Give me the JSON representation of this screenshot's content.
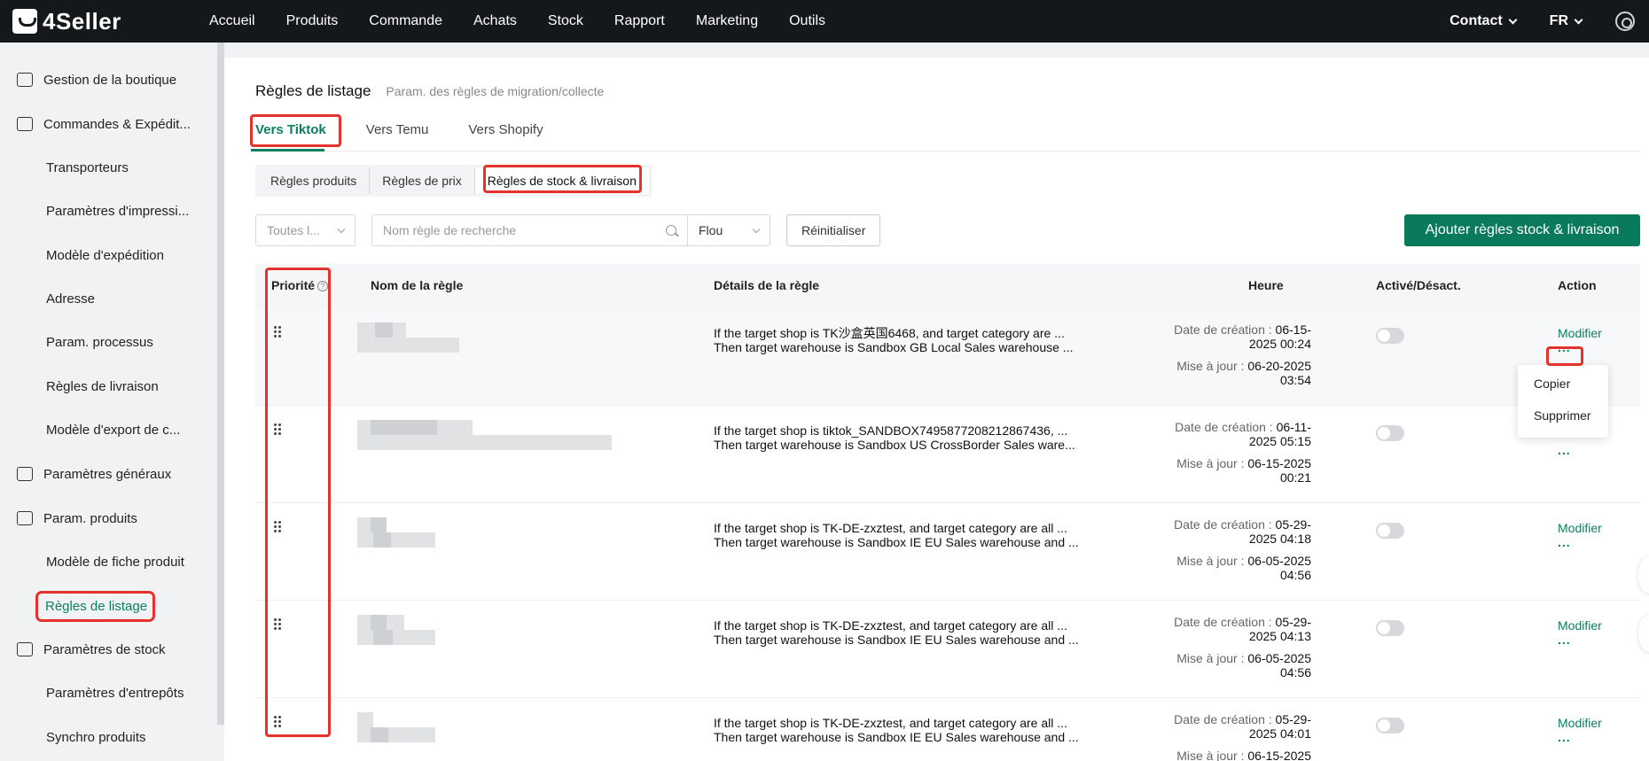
{
  "app": {
    "brand": "4Seller"
  },
  "top_nav": [
    "Accueil",
    "Produits",
    "Commande",
    "Achats",
    "Stock",
    "Rapport",
    "Marketing",
    "Outils"
  ],
  "top_right": {
    "contact": "Contact",
    "lang": "FR"
  },
  "sidebar": {
    "items": [
      {
        "label": "Gestion de la boutique",
        "icon": "shop-icon",
        "type": "section"
      },
      {
        "label": "Commandes & Expédit...",
        "icon": "orders-icon",
        "type": "section"
      },
      {
        "label": "Transporteurs",
        "type": "sub"
      },
      {
        "label": "Paramètres d'impressi...",
        "type": "sub"
      },
      {
        "label": "Modèle d'expédition",
        "type": "sub"
      },
      {
        "label": "Adresse",
        "type": "sub"
      },
      {
        "label": "Param. processus",
        "type": "sub"
      },
      {
        "label": "Règles de livraison",
        "type": "sub"
      },
      {
        "label": "Modèle d'export de c...",
        "type": "sub"
      },
      {
        "label": "Paramètres généraux",
        "icon": "settings-icon",
        "type": "section"
      },
      {
        "label": "Param. produits",
        "icon": "product-icon",
        "type": "section"
      },
      {
        "label": "Modèle de fiche produit",
        "type": "sub"
      },
      {
        "label": "Règles de listage",
        "type": "sub",
        "active": true
      },
      {
        "label": "Paramètres de stock",
        "icon": "stock-icon",
        "type": "section"
      },
      {
        "label": "Paramètres d'entrepôts",
        "type": "sub"
      },
      {
        "label": "Synchro produits",
        "type": "sub"
      }
    ]
  },
  "page": {
    "title": "Règles de listage",
    "subtitle": "Param. des règles de migration/collecte",
    "tabs": [
      "Vers Tiktok",
      "Vers Temu",
      "Vers Shopify"
    ],
    "active_tab": "Vers Tiktok",
    "segments": [
      "Règles produits",
      "Règles de prix",
      "Règles de stock & livraison"
    ],
    "active_segment": "Règles de stock & livraison"
  },
  "filters": {
    "shop_select": "Toutes l...",
    "search_placeholder": "Nom règle de recherche",
    "match_mode": "Flou",
    "reset_label": "Réinitialiser",
    "add_label": "Ajouter règles stock & livraison"
  },
  "table": {
    "headers": {
      "priority": "Priorité",
      "name": "Nom de la règle",
      "details": "Détails de la règle",
      "time": "Heure",
      "enabled": "Activé/Désact.",
      "action": "Action"
    },
    "created_label": "Date de création :",
    "updated_label": "Mise à jour :",
    "edit_label": "Modifier",
    "more_label": "...",
    "rows": [
      {
        "detail1": "If the target shop is TK沙盒英国6468, and target category are ...",
        "detail2": "Then target warehouse is Sandbox GB Local Sales warehouse ...",
        "created1": "06-15-",
        "created2": "2025 00:24",
        "updated1": "06-20-2025",
        "updated2": "03:54",
        "enabled": false
      },
      {
        "detail1": "If the target shop is tiktok_SANDBOX7495877208212867436, ...",
        "detail2": "Then target warehouse is Sandbox US CrossBorder Sales ware...",
        "created1": "06-11-",
        "created2": "2025 05:15",
        "updated1": "06-15-2025",
        "updated2": "00:21",
        "enabled": false
      },
      {
        "detail1": "If the target shop is TK-DE-zxztest, and target category are all ...",
        "detail2": "Then target warehouse is Sandbox IE EU Sales warehouse and ...",
        "created1": "05-29-",
        "created2": "2025 04:18",
        "updated1": "06-05-2025",
        "updated2": "04:56",
        "enabled": false
      },
      {
        "detail1": "If the target shop is TK-DE-zxztest, and target category are all ...",
        "detail2": "Then target warehouse is Sandbox IE EU Sales warehouse and ...",
        "created1": "05-29-",
        "created2": "2025 04:13",
        "updated1": "06-05-2025",
        "updated2": "04:56",
        "enabled": false
      },
      {
        "detail1": "If the target shop is TK-DE-zxztest, and target category are all ...",
        "detail2": "Then target warehouse is Sandbox IE EU Sales warehouse and ...",
        "created1": "05-29-",
        "created2": "2025 04:01",
        "updated1": "06-15-2025",
        "updated2": "",
        "enabled": false
      }
    ]
  },
  "menu": {
    "copy": "Copier",
    "delete": "Supprimer"
  },
  "colors": {
    "accent": "#0a8060",
    "highlight": "#e5322d",
    "topbar": "#14181b"
  }
}
